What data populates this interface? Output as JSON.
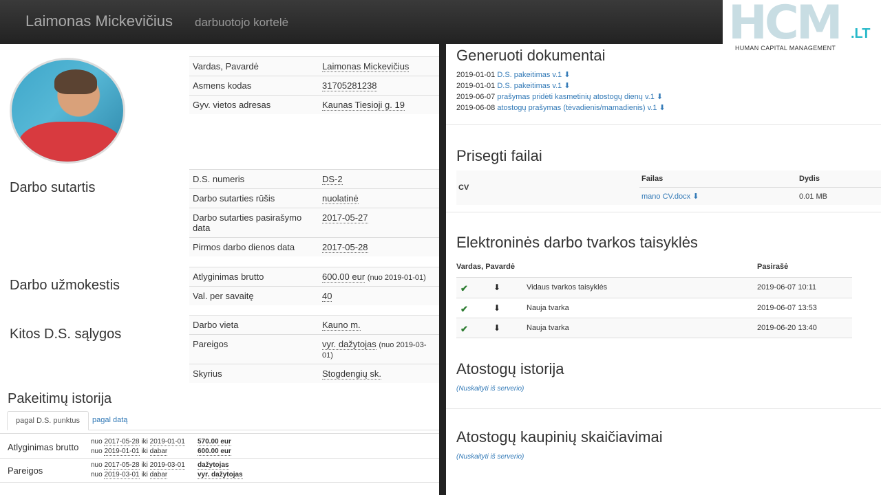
{
  "header": {
    "name": "Laimonas Mickevičius",
    "subtitle": "darbuotojo kortelė"
  },
  "logo": {
    "big": "HCM",
    "suffix": ".LT",
    "tagline": "HUMAN CAPITAL MANAGEMENT"
  },
  "personal": [
    {
      "label": "Vardas, Pavardė",
      "value": "Laimonas Mickevičius"
    },
    {
      "label": "Asmens kodas",
      "value": "31705281238"
    },
    {
      "label": "Gyv. vietos adresas",
      "value": "Kaunas Tiesioji g. 19"
    }
  ],
  "sections": {
    "contract": "Darbo sutartis",
    "salary": "Darbo užmokestis",
    "other": "Kitos D.S. sąlygos"
  },
  "contract": [
    {
      "label": "D.S. numeris",
      "value": "DS-2"
    },
    {
      "label": "Darbo sutarties rūšis",
      "value": "nuolatinė"
    },
    {
      "label": "Darbo sutarties pasirašymo data",
      "value": "2017-05-27"
    },
    {
      "label": "Pirmos darbo dienos data",
      "value": "2017-05-28"
    }
  ],
  "salary": [
    {
      "label": "Atlyginimas brutto",
      "value": "600.00 eur",
      "note": "(nuo 2019-01-01)"
    },
    {
      "label": "Val. per savaitę",
      "value": "40",
      "note": ""
    }
  ],
  "other": [
    {
      "label": "Darbo vieta",
      "value": "Kauno m.",
      "note": ""
    },
    {
      "label": "Pareigos",
      "value": "vyr. dažytojas",
      "note": "(nuo 2019-03-01)"
    },
    {
      "label": "Skyrius",
      "value": "Stogdengių sk.",
      "note": ""
    }
  ],
  "history": {
    "title": "Pakeitimų istorija",
    "tab_active": "pagal D.S. punktus",
    "tab_inactive": "pagal datą",
    "rows": [
      {
        "label": "Atlyginimas brutto",
        "lines": [
          {
            "from": "nuo",
            "start": "2017-05-28",
            "to": "iki",
            "end": "2019-01-01",
            "value": "570.00 eur"
          },
          {
            "from": "nuo",
            "start": "2019-01-01",
            "to": "iki",
            "end": "dabar",
            "value": "600.00 eur"
          }
        ]
      },
      {
        "label": "Pareigos",
        "lines": [
          {
            "from": "nuo",
            "start": "2017-05-28",
            "to": "iki",
            "end": "2019-03-01",
            "value": "dažytojas"
          },
          {
            "from": "nuo",
            "start": "2019-03-01",
            "to": "iki",
            "end": "dabar",
            "value": "vyr. dažytojas"
          }
        ]
      }
    ]
  },
  "generated": {
    "title": "Generuoti dokumentai",
    "items": [
      {
        "date": "2019-01-01",
        "name": "D.S. pakeitimas v.1"
      },
      {
        "date": "2019-01-01",
        "name": "D.S. pakeitimas v.1"
      },
      {
        "date": "2019-06-07",
        "name": "prašymas pridėti kasmetinių atostogų dienų v.1"
      },
      {
        "date": "2019-06-08",
        "name": "atostogų prašymas (tėvadienis/mamadienis) v.1"
      }
    ]
  },
  "files": {
    "title": "Prisegti failai",
    "col_file": "Failas",
    "col_size": "Dydis",
    "rows": [
      {
        "type": "CV",
        "file": "mano CV.docx",
        "size": "0.01 MB"
      }
    ]
  },
  "rules": {
    "title": "Elektroninės darbo tvarkos taisyklės",
    "col_name": "Vardas, Pavardė",
    "col_signed": "Pasirašė",
    "rows": [
      {
        "name": "Vidaus tvarkos taisyklės",
        "date": "2019-06-07 10:11"
      },
      {
        "name": "Nauja tvarka",
        "date": "2019-06-07 13:53"
      },
      {
        "name": "Nauja tvarka",
        "date": "2019-06-20 13:40"
      }
    ]
  },
  "vacation": {
    "title": "Atostogų istorija",
    "load": "(Nuskaityti iš serverio)"
  },
  "accrual": {
    "title": "Atostogų kaupinių skaičiavimai",
    "load": "(Nuskaityti iš serverio)"
  }
}
